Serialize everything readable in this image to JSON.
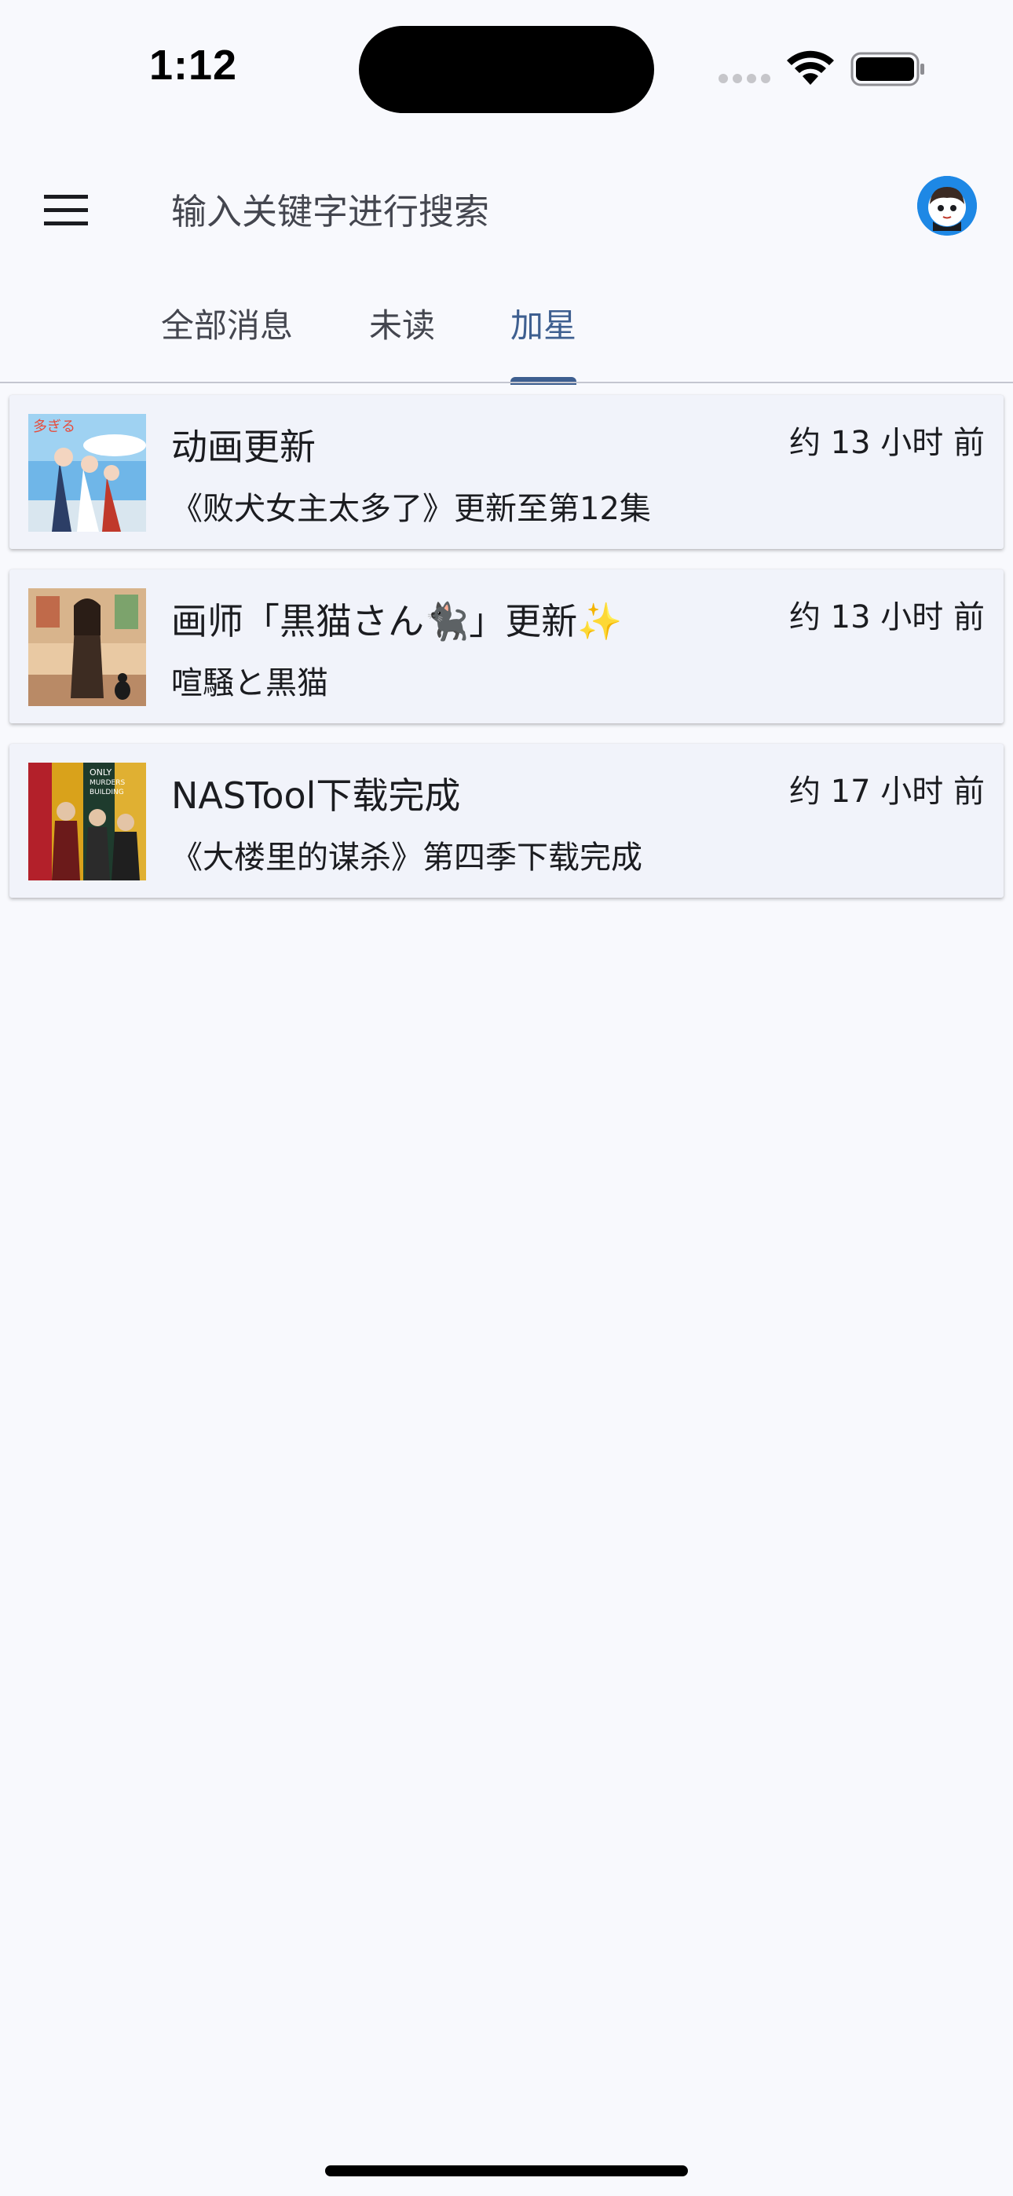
{
  "status_bar": {
    "time": "1:12",
    "icons": [
      "signal-icon",
      "wifi-icon",
      "battery-icon"
    ]
  },
  "top_bar": {
    "menu_icon": "menu-icon",
    "search_placeholder": "输入关键字进行搜索",
    "avatar_icon": "avatar-icon"
  },
  "tabs": [
    {
      "label": "全部消息",
      "active": false
    },
    {
      "label": "未读",
      "active": false
    },
    {
      "label": "加星",
      "active": true
    }
  ],
  "messages": [
    {
      "title": "动画更新",
      "time": "约 13 小时 前",
      "body": "《败犬女主太多了》更新至第12集"
    },
    {
      "title": "画师「黒猫さん🐈‍⬛」更新✨",
      "time": "约 13 小时 前",
      "body": "喧騒と黒猫"
    },
    {
      "title": "NASTool下载完成",
      "time": "约 17 小时 前",
      "body": "《大楼里的谋杀》第四季下载完成"
    }
  ],
  "colors": {
    "background": "#f8f9fd",
    "card": "#f1f3fa",
    "accent": "#3e5f90",
    "avatar": "#1e88e5"
  }
}
